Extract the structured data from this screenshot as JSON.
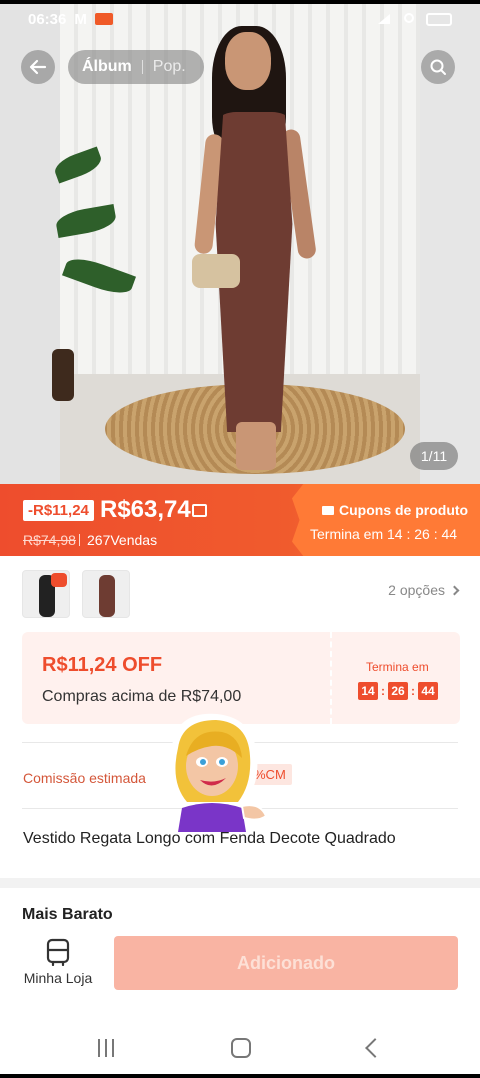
{
  "status_bar": {
    "time": "06:36"
  },
  "header": {
    "tabs": [
      "Álbum",
      "Pop."
    ],
    "image_counter": "1/11"
  },
  "price": {
    "discount": "-R$11,24",
    "current": "R$63,74",
    "original": "R$74,98",
    "sold": "267Vendas"
  },
  "coupon": {
    "title": "Cupons de produto",
    "timer": "Termina em 14 : 26 : 44"
  },
  "variants": {
    "options": "2 opções"
  },
  "voucher": {
    "amount": "R$11,24 OFF",
    "condition": "Compras acima de R$74,00",
    "ends_label": "Termina em",
    "hours": "14",
    "minutes": "26",
    "seconds": "44"
  },
  "commission": {
    "label": "Comissão estimada",
    "badge": "%CM"
  },
  "product": {
    "title": "Vestido Regata Longo com Fenda Decote Quadrado"
  },
  "section": {
    "title": "Mais Barato"
  },
  "bottom_bar": {
    "store_label": "Minha Loja",
    "add_button": "Adicionado"
  },
  "colors": {
    "accent": "#ee4d2d",
    "coupon": "#ff7a36",
    "button_disabled": "#f9b4a3"
  }
}
